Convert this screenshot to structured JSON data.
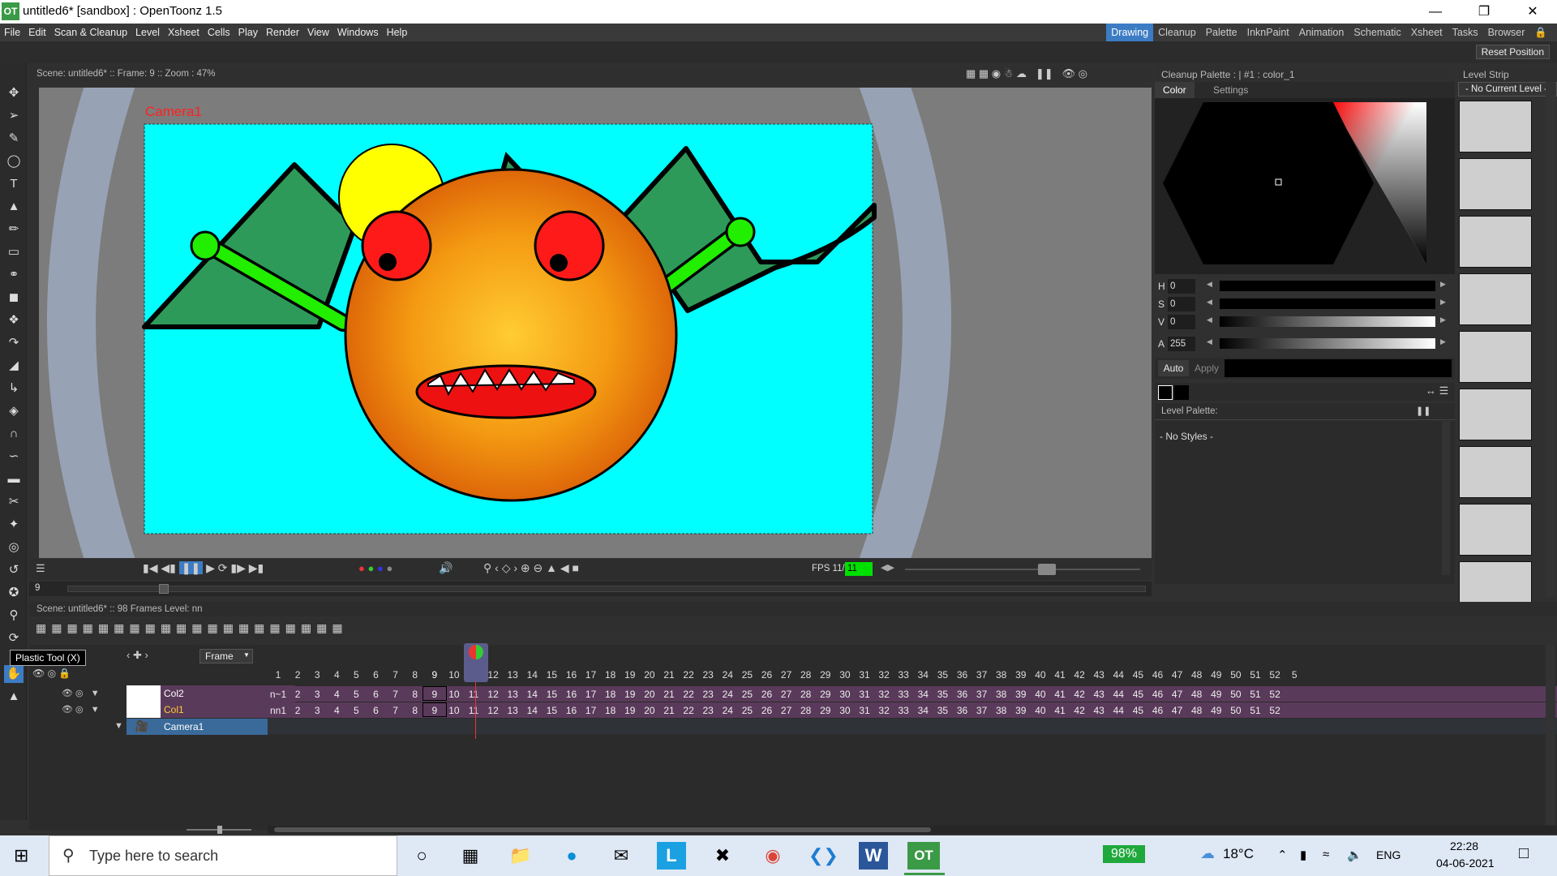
{
  "window": {
    "title": "untitled6* [sandbox] : OpenToonz 1.5",
    "app_icon": "OT"
  },
  "menu": [
    "File",
    "Edit",
    "Scan & Cleanup",
    "Level",
    "Xsheet",
    "Cells",
    "Play",
    "Render",
    "View",
    "Windows",
    "Help"
  ],
  "rooms": {
    "items": [
      "Drawing",
      "Cleanup",
      "Palette",
      "InknPaint",
      "Animation",
      "Schematic",
      "Xsheet",
      "Tasks",
      "Browser"
    ],
    "active": "Drawing"
  },
  "reset_position": "Reset Position",
  "viewer": {
    "header": "Scene: untitled6*  ::  Frame: 9  ::  Zoom : 47%",
    "camera_label": "Camera1",
    "fps_label": "FPS 11/",
    "fps_value": "11",
    "frame_field": "9"
  },
  "style_editor": {
    "header": "Cleanup Palette : | #1 : color_1",
    "tabs": [
      "Color",
      "Settings"
    ],
    "h": "0",
    "s": "0",
    "v": "0",
    "a": "255",
    "auto_label": "Auto",
    "apply_label": "Apply"
  },
  "level_palette": {
    "title": "Level Palette:",
    "empty": "- No Styles -"
  },
  "level_strip": {
    "title": "Level Strip",
    "combo": "- No Current Level -"
  },
  "xsheet": {
    "header": "Scene: untitled6*   ::   98 Frames  Level: nn",
    "frame_mode": "Frame",
    "tooltip": "Plastic Tool (X)",
    "current_frame": "9",
    "columns": [
      {
        "name": "Col2",
        "first": "n~1"
      },
      {
        "name": "Col1",
        "first": "nn1"
      },
      {
        "name": "Camera1",
        "first": ""
      }
    ],
    "frame_numbers": [
      "1",
      "2",
      "3",
      "4",
      "5",
      "6",
      "7",
      "8",
      "9",
      "10",
      "11",
      "12",
      "13",
      "14",
      "15",
      "16",
      "17",
      "18",
      "19",
      "20",
      "21",
      "22",
      "23",
      "24",
      "25",
      "26",
      "27",
      "28",
      "29",
      "30",
      "31",
      "32",
      "33",
      "34",
      "35",
      "36",
      "37",
      "38",
      "39",
      "40",
      "41",
      "42",
      "43",
      "44",
      "45",
      "46",
      "47",
      "48",
      "49",
      "50",
      "51",
      "52",
      "5"
    ],
    "cell_numbers": [
      "2",
      "3",
      "4",
      "5",
      "6",
      "7",
      "8",
      "9",
      "10",
      "11",
      "12",
      "13",
      "14",
      "15",
      "16",
      "17",
      "18",
      "19",
      "20",
      "21",
      "22",
      "23",
      "24",
      "25",
      "26",
      "27",
      "28",
      "29",
      "30",
      "31",
      "32",
      "33",
      "34",
      "35",
      "36",
      "37",
      "38",
      "39",
      "40",
      "41",
      "42",
      "43",
      "44",
      "45",
      "46",
      "47",
      "48",
      "49",
      "50",
      "51",
      "52"
    ]
  },
  "taskbar": {
    "search_placeholder": "Type here to search",
    "battery": "98%",
    "temperature": "18°C",
    "language": "ENG",
    "time": "22:28",
    "date": "04-06-2021"
  },
  "colors": {
    "camera_bg": "#00ffff",
    "accent": "#3c7cc4",
    "cell_purple": "#5a3a5a",
    "fps_green": "#00e000"
  }
}
